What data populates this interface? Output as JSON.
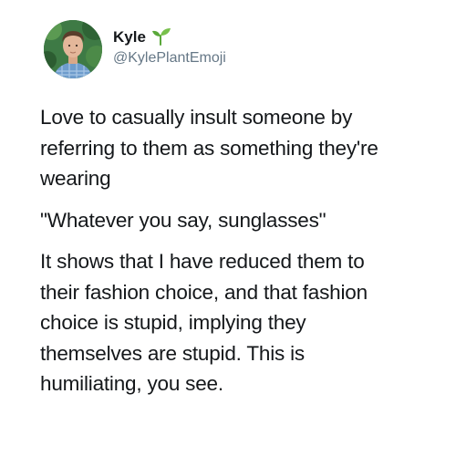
{
  "tweet": {
    "author": {
      "display_name": "Kyle",
      "handle": "@KylePlantEmoji",
      "name_emoji_icon": "seedling-icon",
      "avatar_icon": "profile-photo"
    },
    "paragraphs": [
      "Love to casually insult someone by\nreferring to them as something they're\nwearing",
      "\"Whatever you say, sunglasses\"",
      "It shows that I have reduced them to\ntheir fashion choice, and that fashion\nchoice is stupid, implying they\nthemselves are stupid. This is\nhumiliating, you see."
    ]
  },
  "colors": {
    "text": "#14171a",
    "handle": "#657786",
    "background": "#ffffff",
    "sprout_green": "#5aa83a"
  }
}
